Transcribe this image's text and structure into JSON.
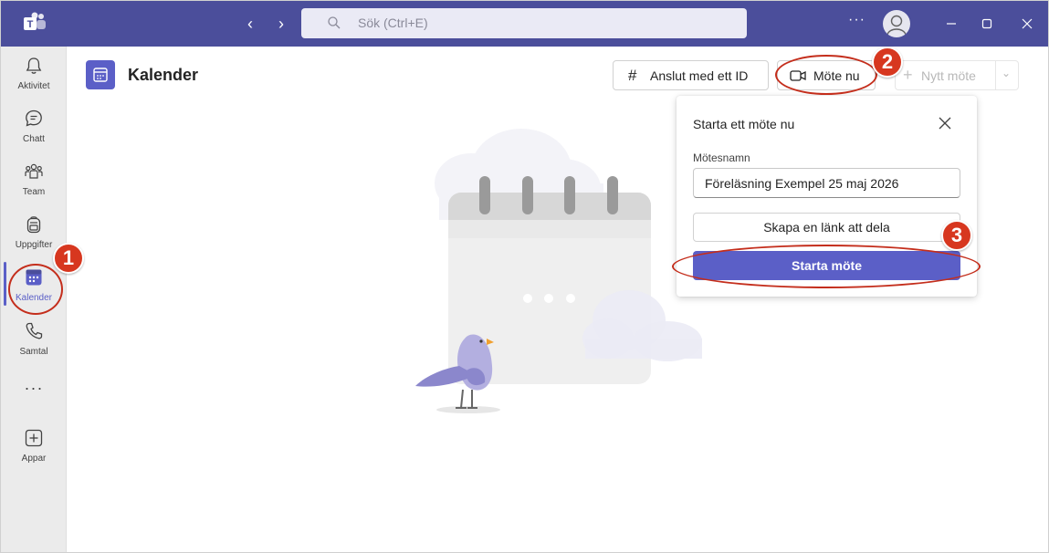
{
  "titlebar": {
    "search_placeholder": "Sök (Ctrl+E)",
    "more": "···",
    "back": "‹",
    "forward": "›"
  },
  "rail": {
    "items": [
      {
        "label": "Aktivitet",
        "icon": "bell-icon"
      },
      {
        "label": "Chatt",
        "icon": "chat-icon"
      },
      {
        "label": "Team",
        "icon": "team-icon"
      },
      {
        "label": "Uppgifter",
        "icon": "backpack-icon"
      },
      {
        "label": "Kalender",
        "icon": "calendar-icon",
        "active": true
      },
      {
        "label": "Samtal",
        "icon": "phone-icon"
      },
      {
        "label": "···",
        "icon": "more-icon"
      },
      {
        "label": "Appar",
        "icon": "add-app-icon"
      }
    ]
  },
  "header": {
    "title": "Kalender",
    "join_label": "Anslut med ett ID",
    "join_icon": "#",
    "meet_now_label": "Möte nu",
    "new_meeting_label": "Nytt möte"
  },
  "popover": {
    "title": "Starta ett möte nu",
    "name_label": "Mötesnamn",
    "name_value": "Föreläsning Exempel 25 maj 2026",
    "link_button": "Skapa en länk att dela",
    "start_button": "Starta möte"
  },
  "annotations": {
    "step1": "1",
    "step2": "2",
    "step3": "3"
  },
  "colors": {
    "titlebar": "#4b4e9b",
    "accent": "#5b5fc7",
    "annotation": "#d7371f"
  }
}
